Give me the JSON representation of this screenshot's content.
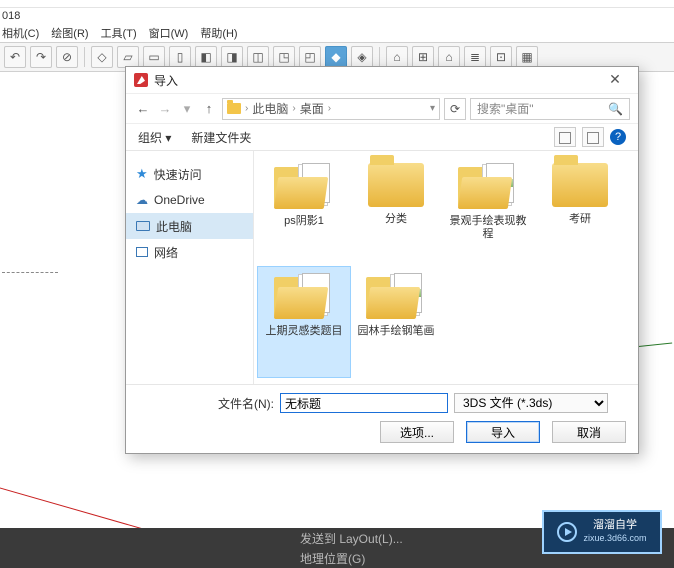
{
  "app_title_suffix": "018",
  "menu": [
    {
      "label": "相机(C)"
    },
    {
      "label": "绘图(R)"
    },
    {
      "label": "工具(T)"
    },
    {
      "label": "窗口(W)"
    },
    {
      "label": "帮助(H)"
    }
  ],
  "dialog": {
    "title": "导入",
    "path": {
      "loc1": "此电脑",
      "loc2": "桌面",
      "search_placeholder": "搜索\"桌面\""
    },
    "sub": {
      "organize": "组织",
      "new_folder": "新建文件夹"
    },
    "sidebar": [
      {
        "label": "快速访问",
        "icon": "star"
      },
      {
        "label": "OneDrive",
        "icon": "cloud"
      },
      {
        "label": "此电脑",
        "icon": "pc",
        "selected": true
      },
      {
        "label": "网络",
        "icon": "net"
      }
    ],
    "files": [
      {
        "label": "ps阴影1",
        "kind": "open"
      },
      {
        "label": "分类",
        "kind": "closed"
      },
      {
        "label": "景观手绘表现教程",
        "kind": "pic"
      },
      {
        "label": "考研",
        "kind": "closed"
      },
      {
        "label": "上期灵感类题目",
        "kind": "open",
        "selected": true
      },
      {
        "label": "园林手绘钢笔画",
        "kind": "pic"
      }
    ],
    "footer": {
      "filename_label": "文件名(N):",
      "filename_value": "无标题",
      "type_value": "3DS 文件 (*.3ds)",
      "options": "选项...",
      "import": "导入",
      "cancel": "取消"
    }
  },
  "context_menu": {
    "item1": "发送到 LayOut(L)...",
    "item2": "地理位置(G)"
  },
  "watermark": {
    "main": "溜溜自学",
    "sub": "zixue.3d66.com"
  }
}
